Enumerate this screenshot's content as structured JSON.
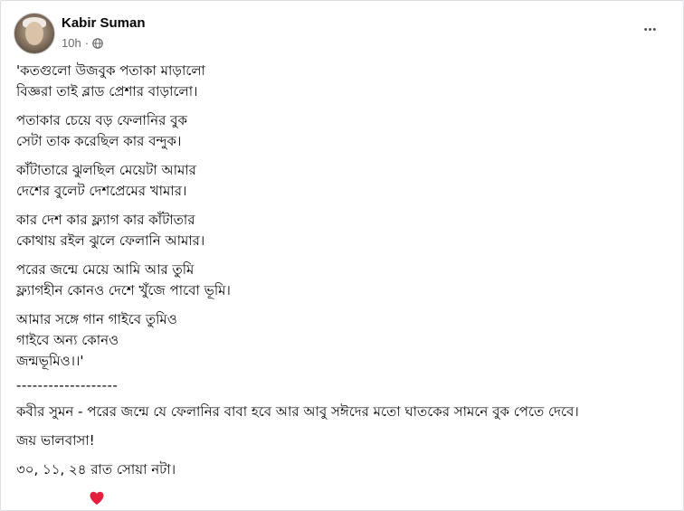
{
  "post": {
    "author": "Kabir Suman",
    "time": "10h",
    "dot": "·",
    "more": "•••"
  },
  "content": {
    "stanzas": [
      [
        "'কতগুলো উজবুক পতাকা মাড়ালো",
        "বিজ্ঞরা তাই ব্লাড প্রেশার বাড়ালো।"
      ],
      [
        "পতাকার চেয়ে বড় ফেলানির বুক",
        "সেটা তাক করেছিল কার বন্দুক।"
      ],
      [
        "কাঁটাতারে ঝুলছিল মেয়েটা আমার",
        "দেশের বুলেট দেশপ্রেমের খামার।"
      ],
      [
        "কার দেশ কার ফ্ল্যাগ কার কাঁটাতার",
        "কোথায় রইল ঝুলে ফেলানি আমার।"
      ],
      [
        "পরের জন্মে মেয়ে আমি আর তুমি",
        "ফ্ল্যাগহীন কোনও দেশে খুঁজে পাবো ভূমি।"
      ],
      [
        "আমার সঙ্গে গান গাইবে তুমিও",
        "গাইবে অন্য কোনও",
        "জন্মভূমিও।।'"
      ]
    ],
    "divider": "-------------------",
    "note": "কবীর সুমন - পরের জন্মে যে ফেলানির বাবা হবে আর আবু সঈদের মতো ঘাতকের সামনে বুক পেতে দেবে।",
    "greeting": "জয় ভালবাসা!",
    "date": "৩০, ১১, ২৪ রাত সোয়া নটা।"
  },
  "icons": {
    "privacy": "globe-icon",
    "reaction": "heart-icon",
    "heart_color": "#e41e3f"
  }
}
